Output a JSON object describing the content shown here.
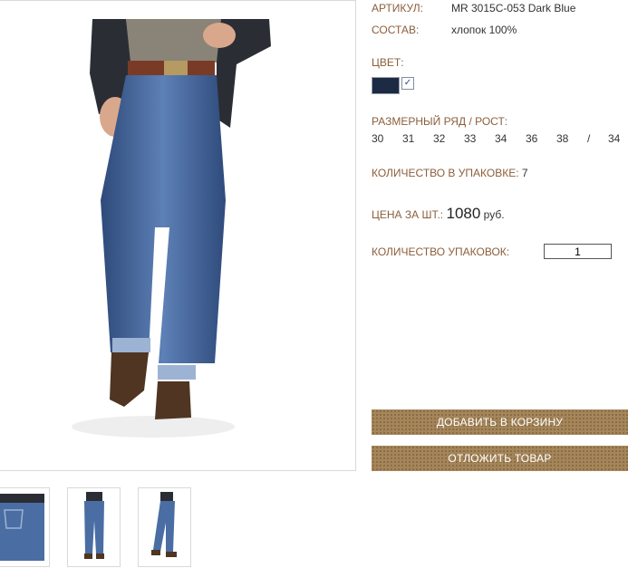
{
  "product": {
    "article_label": "АРТИКУЛ:",
    "article_value": "MR 3015C-053 Dark Blue",
    "composition_label": "СОСТАВ:",
    "composition_value": "хлопок 100%",
    "color_label": "ЦВЕТ:",
    "color_swatch": "#1d2a44",
    "color_checked": true,
    "sizes_label": "РАЗМЕРНЫЙ РЯД / РОСТ:",
    "sizes": [
      "30",
      "31",
      "32",
      "33",
      "34",
      "36",
      "38",
      "/",
      "34"
    ],
    "pack_qty_label": "КОЛИЧЕСТВО В УПАКОВКЕ:",
    "pack_qty_value": "7",
    "price_label": "ЦЕНА ЗА ШТ.:",
    "price_value": "1080",
    "price_currency": "руб.",
    "packs_label": "КОЛИЧЕСТВО УПАКОВОК:",
    "packs_value": "1"
  },
  "actions": {
    "add_to_cart": "ДОБАВИТЬ В КОРЗИНУ",
    "save_item": "ОТЛОЖИТЬ ТОВАР"
  },
  "colors": {
    "label_brown": "#8b5e3c",
    "button_bg": "#a5865a",
    "denim": "#3f5f92"
  }
}
